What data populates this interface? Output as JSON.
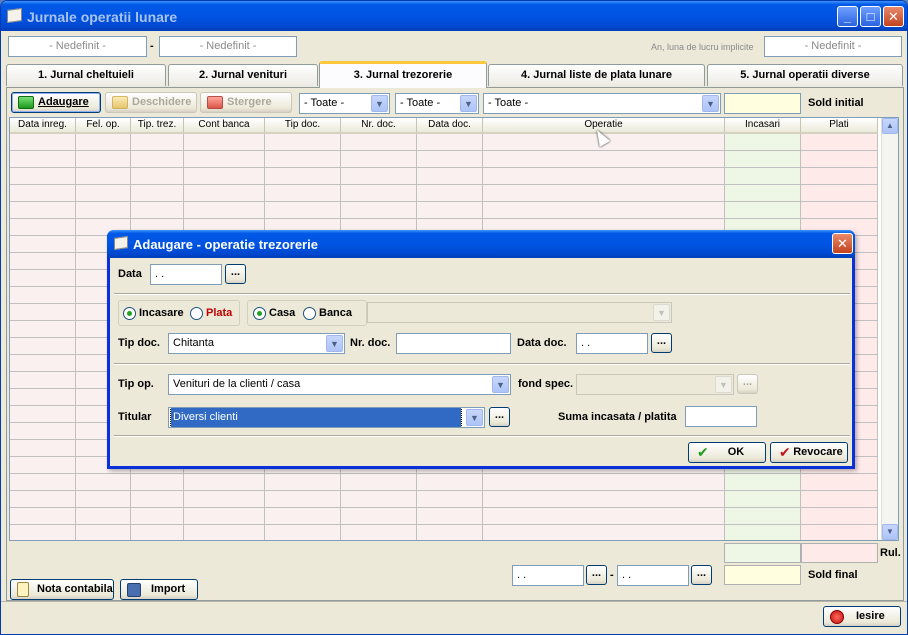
{
  "window": {
    "title": "Jurnale operatii lunare",
    "minimize": "_",
    "maximize": "□",
    "close": "✕"
  },
  "period": {
    "from": "- Nedefinit -",
    "separator": "-",
    "to": "- Nedefinit -",
    "work_month_label": "An, luna de lucru implicite",
    "work_month_value": "- Nedefinit -"
  },
  "tabs": [
    {
      "label": "1. Jurnal cheltuieli"
    },
    {
      "label": "2. Jurnal venituri"
    },
    {
      "label": "3. Jurnal trezorerie",
      "active": true
    },
    {
      "label": "4. Jurnal liste de plata lunare"
    },
    {
      "label": "5. Jurnal operatii diverse"
    }
  ],
  "toolbar": {
    "add_label": "Adaugare",
    "open_label": "Deschidere",
    "delete_label": "Stergere",
    "filter1": "- Toate -",
    "filter2": "- Toate -",
    "filter3": "- Toate -",
    "sold_initial_label": "Sold initial",
    "sold_initial_value": ""
  },
  "grid": {
    "columns": [
      "Data inreg.",
      "Fel. op.",
      "Tip. trez.",
      "Cont banca",
      "Tip doc.",
      "Nr. doc.",
      "Data doc.",
      "Operatie",
      "Incasari",
      "Plati"
    ]
  },
  "totals": {
    "rul_label": "Rul.",
    "sold_final_label": "Sold final",
    "date_from": " .  .",
    "date_to": " .  .",
    "date_sep": "-",
    "browse": "..."
  },
  "bottom": {
    "nota_label": "Nota contabila",
    "import_label": "Import",
    "exit_label": "Iesire"
  },
  "dialog": {
    "title": "Adaugare - operatie trezorerie",
    "close": "✕",
    "data_label": "Data",
    "data_value": " .  .",
    "browse": "...",
    "radio_incasare": "Incasare",
    "radio_plata": "Plata",
    "radio_casa": "Casa",
    "radio_banca": "Banca",
    "bank_combo": "",
    "tip_doc_label": "Tip doc.",
    "tip_doc_value": "Chitanta",
    "nr_doc_label": "Nr. doc.",
    "nr_doc_value": "",
    "data_doc_label": "Data doc.",
    "data_doc_value": " .  .",
    "tip_op_label": "Tip op.",
    "tip_op_value": "Venituri de la clienti / casa",
    "fond_label": "fond spec.",
    "fond_value": "",
    "titular_label": "Titular",
    "titular_value": "Diversi clienti",
    "suma_label": "Suma incasata / platita",
    "suma_value": "",
    "ok_label": "OK",
    "cancel_label": "Revocare"
  },
  "colors": {
    "titlebar": "#0054e3",
    "accent_tab": "#ffc83c",
    "plata_red": "#c00000",
    "incasari_bg": "#eef6e6",
    "plati_bg": "#ffeaea"
  }
}
